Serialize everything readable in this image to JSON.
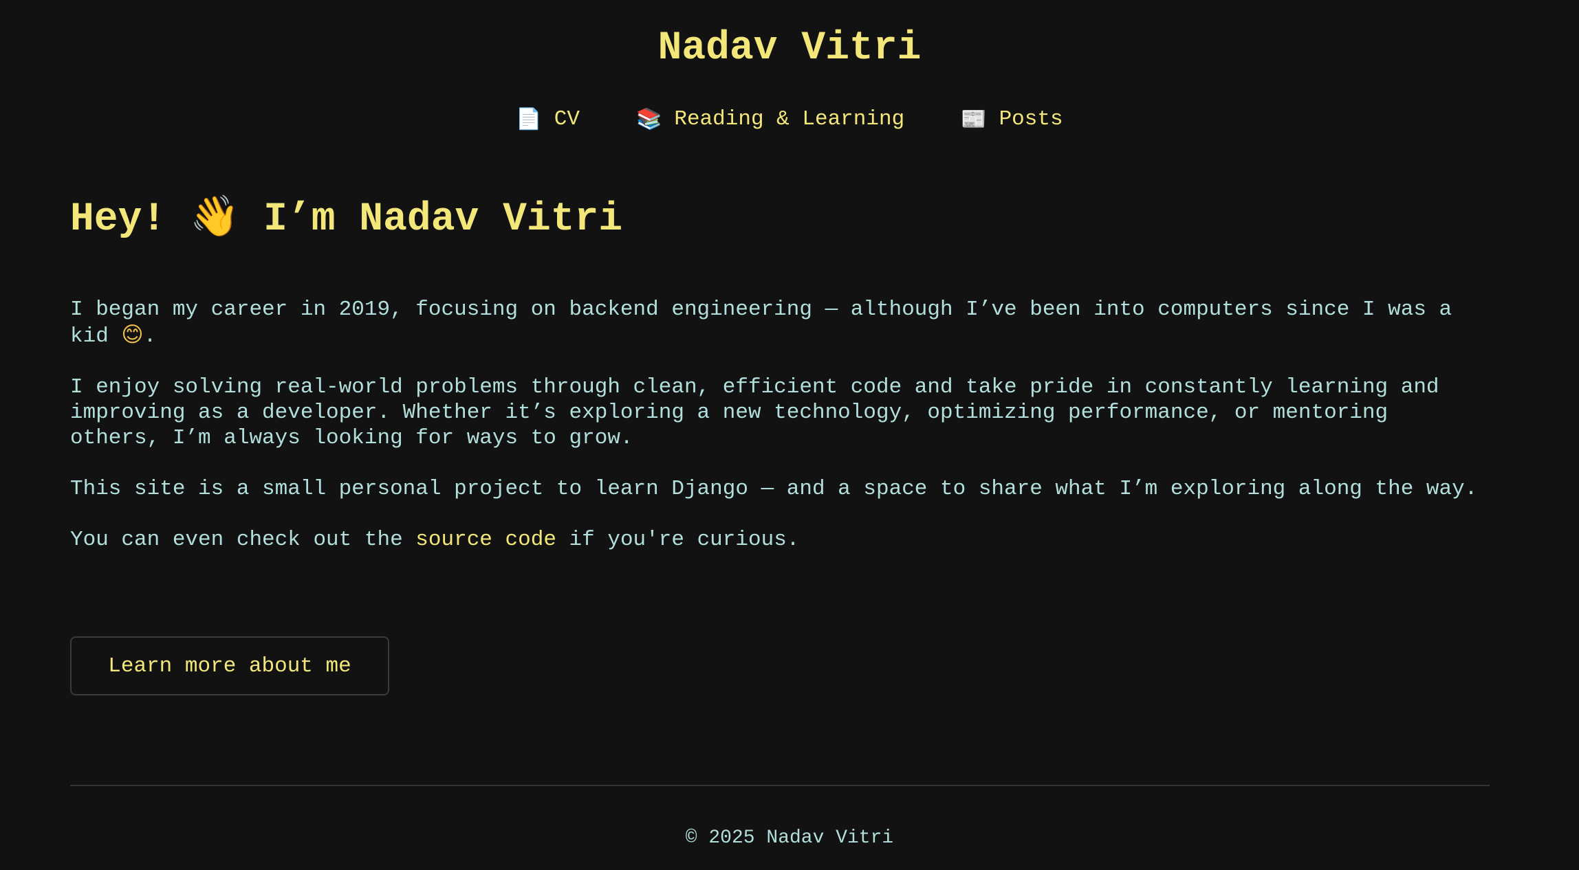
{
  "header": {
    "site_title": "Nadav Vitri",
    "nav": [
      {
        "icon": "page-icon",
        "glyph": "📄",
        "label": "CV"
      },
      {
        "icon": "books-icon",
        "glyph": "📚",
        "label": "Reading & Learning"
      },
      {
        "icon": "newspaper-icon",
        "glyph": "📰",
        "label": "Posts"
      }
    ]
  },
  "main": {
    "heading_before": "Hey!",
    "heading_emoji": "👋",
    "heading_after": "I’m Nadav Vitri",
    "p1_text": "I began my career in 2019, focusing on backend engineering — although I’ve been into computers since I was a kid",
    "p1_emoji": "😊",
    "p1_end": ".",
    "p2": "I enjoy solving real-world problems through clean, efficient code and take pride in constantly learning and improving as a developer. Whether it’s exploring a new technology, optimizing performance, or mentoring others, I’m always looking for ways to grow.",
    "p3": "This site is a small personal project to learn Django — and a space to share what I’m exploring along the way.",
    "p4_before": "You can even check out the",
    "p4_link": "source code",
    "p4_after": "if you're curious.",
    "button_label": "Learn more about me"
  },
  "footer": {
    "text": "© 2025 Nadav Vitri"
  },
  "colors": {
    "background": "#121212",
    "accent": "#f3e77a",
    "text": "#b2dfdb",
    "border": "#3a3a3a"
  }
}
